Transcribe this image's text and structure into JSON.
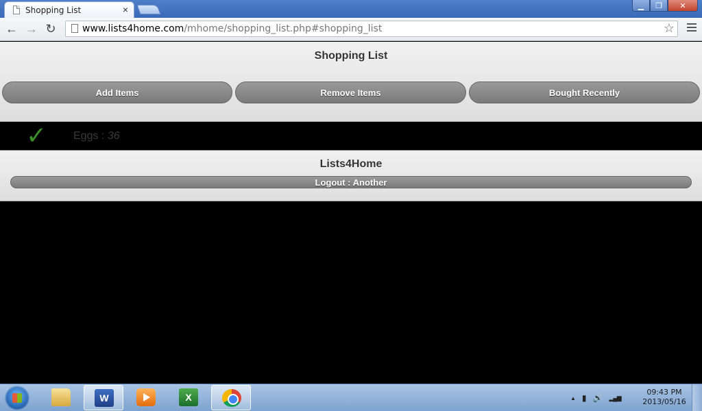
{
  "browser": {
    "tab_title": "Shopping List",
    "tab_close": "×",
    "url_host": "www.lists4home.com",
    "url_path": "/mhome/shopping_list.php#shopping_list",
    "back_glyph": "←",
    "forward_glyph": "→",
    "reload_glyph": "↻",
    "star_glyph": "☆",
    "min_glyph": "▁",
    "max_glyph": "❐",
    "close_glyph": "✕"
  },
  "page": {
    "title": "Shopping List",
    "nav_buttons": [
      "Add Items",
      "Remove Items",
      "Bought Recently"
    ],
    "items": [
      {
        "name": "Eggs",
        "separator": " : ",
        "quantity": "36",
        "checked": true
      }
    ],
    "check_glyph": "✓",
    "footer_title": "Lists4Home",
    "logout_label": "Logout : Another"
  },
  "taskbar": {
    "apps": [
      "folder-icon",
      "word-icon",
      "media-player-icon",
      "excel-icon",
      "chrome-icon"
    ],
    "word_letter": "W",
    "excel_letter": "X",
    "tray_up_glyph": "▲",
    "tray_battery_glyph": "▮",
    "tray_volume_glyph": "🔊",
    "tray_signal_glyph": "▂▄▆",
    "time": "09:43 PM",
    "date": "2013/05/16"
  },
  "colors": {
    "check": "#3d8c2a",
    "button": "#8a8a8a",
    "titlebar": "#4f7fc8"
  }
}
